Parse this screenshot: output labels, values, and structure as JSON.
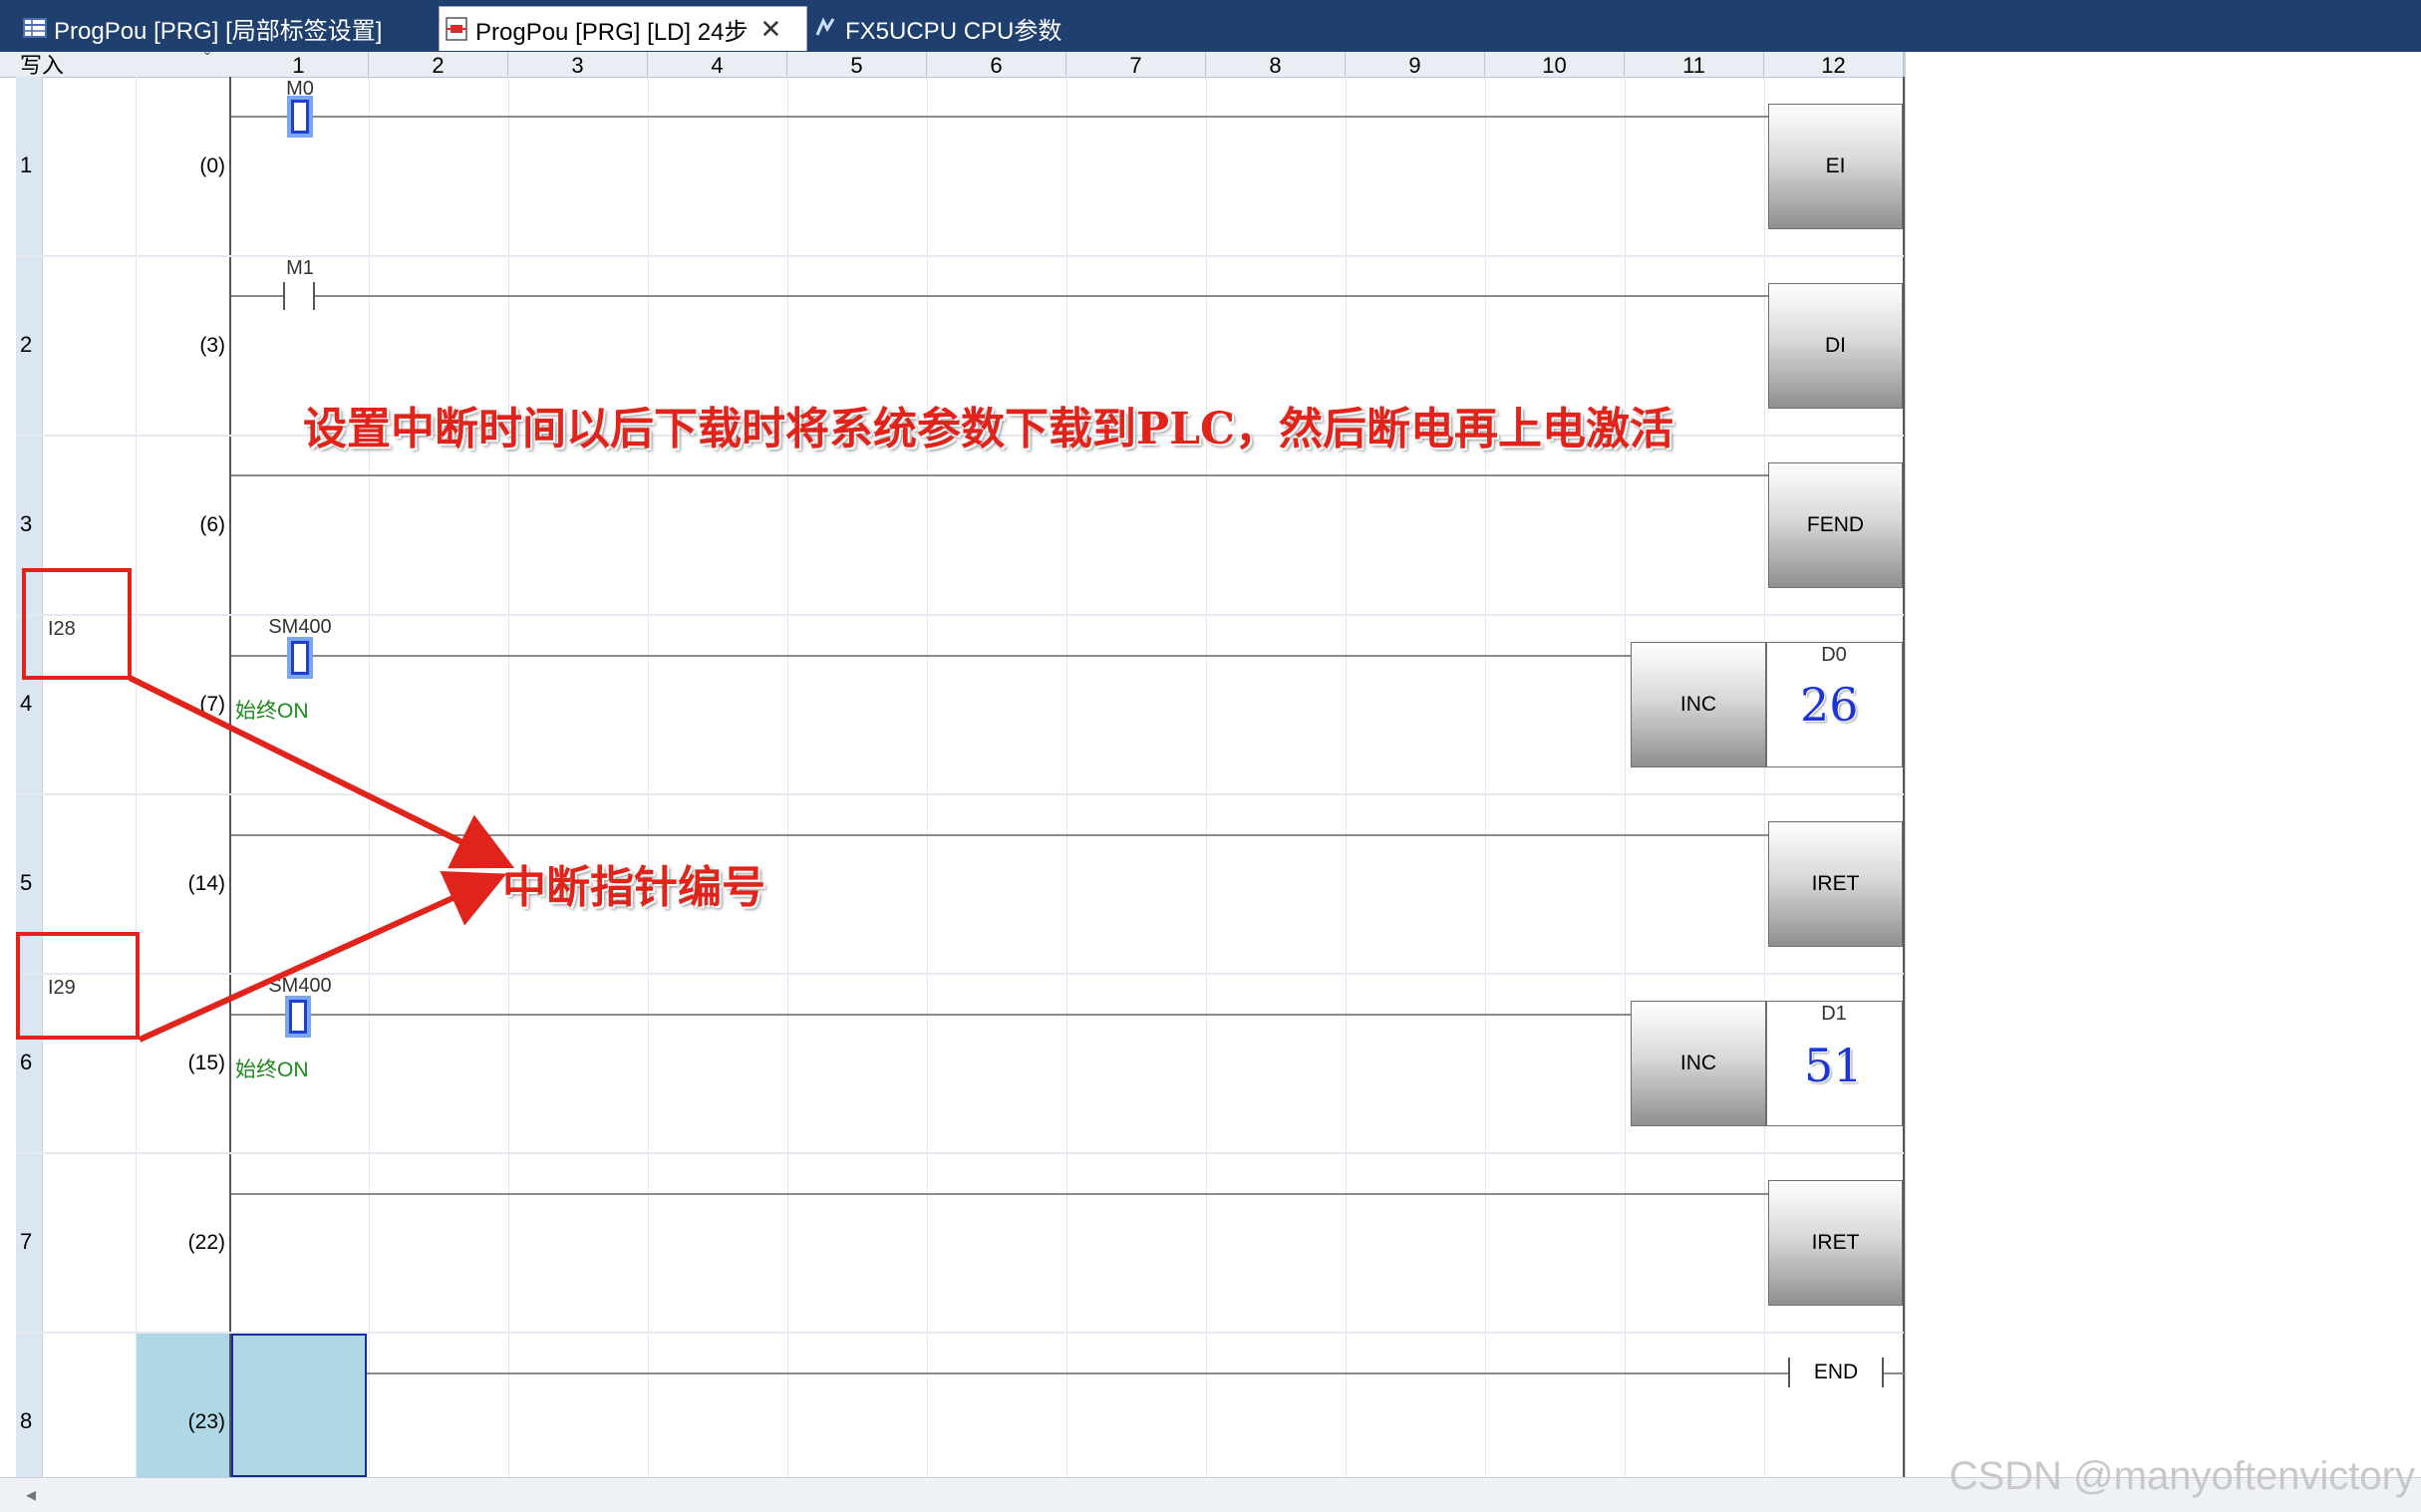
{
  "tabs": [
    {
      "label": "ProgPou [PRG] [局部标签设置]",
      "icon": "table-icon",
      "active": false
    },
    {
      "label": "ProgPou [PRG] [LD] 24步",
      "icon": "ladder-icon",
      "active": true
    },
    {
      "label": "FX5UCPU CPU参数",
      "icon": "parameter-icon",
      "active": false
    }
  ],
  "column_header": {
    "mode": "写入",
    "columns": [
      "1",
      "2",
      "3",
      "4",
      "5",
      "6",
      "7",
      "8",
      "9",
      "10",
      "11",
      "12"
    ]
  },
  "rows": [
    {
      "num": "1",
      "step": "(0)"
    },
    {
      "num": "2",
      "step": "(3)"
    },
    {
      "num": "3",
      "step": "(6)"
    },
    {
      "num": "4",
      "step": "(7)"
    },
    {
      "num": "5",
      "step": "(14)"
    },
    {
      "num": "6",
      "step": "(15)"
    },
    {
      "num": "7",
      "step": "(22)"
    },
    {
      "num": "8",
      "step": "(23)"
    }
  ],
  "devices": {
    "m0": "M0",
    "m1": "M1",
    "sm400_a": "SM400",
    "sm400_b": "SM400",
    "always_on_a": "始终ON",
    "always_on_b": "始终ON",
    "label_i28": "I28",
    "label_i29": "I29"
  },
  "instructions": {
    "ei": "EI",
    "di": "DI",
    "fend": "FEND",
    "inc_a": "INC",
    "inc_b": "INC",
    "iret_a": "IRET",
    "iret_b": "IRET",
    "end": "END"
  },
  "operands": {
    "d0_name": "D0",
    "d0_value": "26",
    "d1_name": "D1",
    "d1_value": "51"
  },
  "annotations": {
    "top_note": "设置中断时间以后下载时将系统参数下载到PLC，然后断电再上电激活",
    "pointer_note": "中断指针编号"
  },
  "watermark": "CSDN @manyoftenvictory",
  "colors": {
    "annotation_red": "#e0241b",
    "value_blue": "#1d34d6",
    "comment_green": "#1d8a1d",
    "tabbar_bg": "#1f3f6e"
  }
}
